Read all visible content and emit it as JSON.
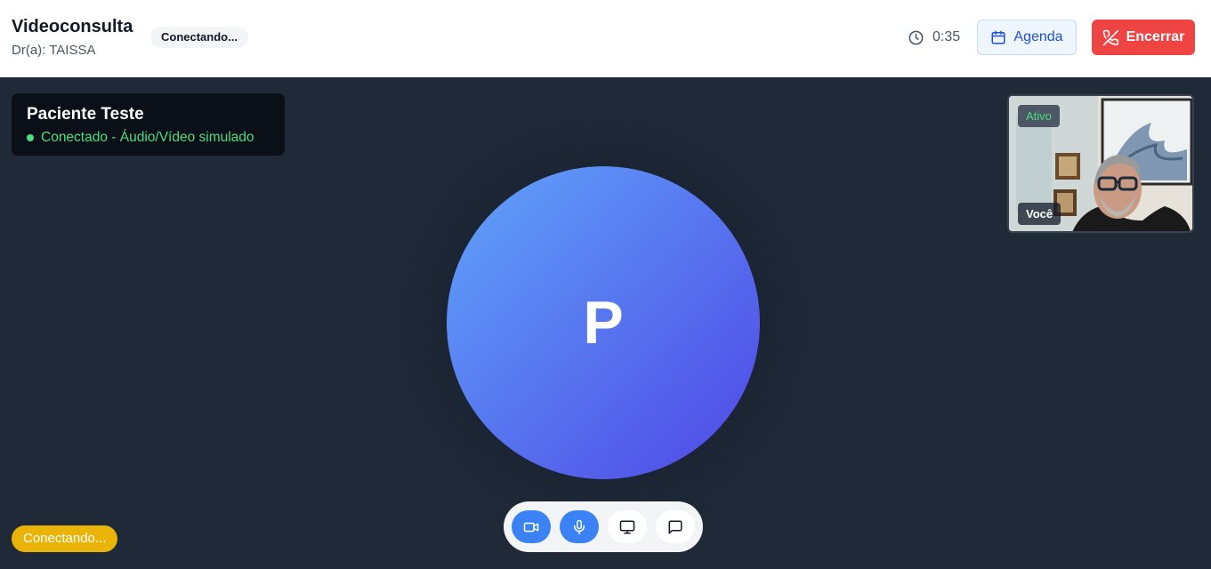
{
  "header": {
    "title": "Videoconsulta",
    "doctor": "Dr(a): TAISSA",
    "status": "Conectando...",
    "timer": "0:35",
    "agenda_label": "Agenda",
    "end_label": "Encerrar"
  },
  "remote": {
    "name": "Paciente Teste",
    "status": "Conectado - Áudio/Vídeo simulado",
    "initial": "P"
  },
  "self_view": {
    "badge": "Ativo",
    "label": "Você"
  },
  "controls": [
    {
      "name": "camera",
      "icon": "video-camera-icon",
      "active": true
    },
    {
      "name": "microphone",
      "icon": "microphone-icon",
      "active": true
    },
    {
      "name": "screen-share",
      "icon": "monitor-icon",
      "active": false
    },
    {
      "name": "chat",
      "icon": "chat-bubble-icon",
      "active": false
    }
  ],
  "connection_status": "Conectando...",
  "colors": {
    "accent": "#3b82f6",
    "danger": "#ef4444",
    "success": "#4ade80",
    "warning": "#eab308",
    "stage": "#1f2937"
  }
}
